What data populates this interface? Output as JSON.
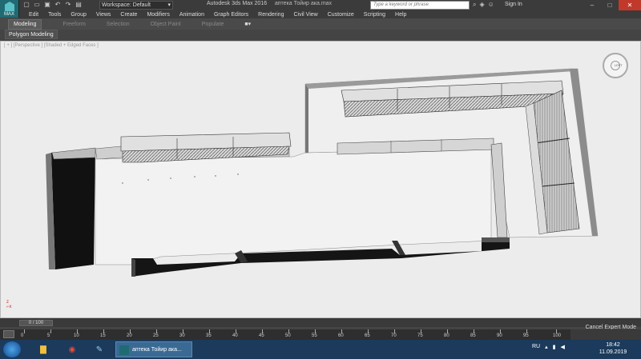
{
  "titlebar": {
    "app_badge": "MAX",
    "workspace": "Workspace: Default",
    "app_title": "Autodesk 3ds Max 2016",
    "file_name": "аптека Тойир ака.max",
    "search_placeholder": "Type a keyword or phrase",
    "sign_in": "Sign In"
  },
  "menu": [
    "Edit",
    "Tools",
    "Group",
    "Views",
    "Create",
    "Modifiers",
    "Animation",
    "Graph Editors",
    "Rendering",
    "Civil View",
    "Customize",
    "Scripting",
    "Help"
  ],
  "ribbon": {
    "tabs": [
      "Modeling",
      "Freeform",
      "Selection",
      "Object Paint",
      "Populate"
    ],
    "panel": "Polygon Modeling"
  },
  "viewport": {
    "label": "[ + ] [Perspective ] [Shaded + Edged Faces ]",
    "viewcube_label": "LEFT"
  },
  "timeline": {
    "frame": "0 / 100",
    "ticks": [
      "0",
      "5",
      "10",
      "15",
      "20",
      "25",
      "30",
      "35",
      "40",
      "45",
      "50",
      "55",
      "60",
      "65",
      "70",
      "75",
      "80",
      "85",
      "90",
      "95",
      "100"
    ],
    "expert_mode": "Cancel Expert Mode"
  },
  "taskbar": {
    "active_window": "аптека Тойир ака...",
    "language": "RU",
    "time": "18:42",
    "date": "11.09.2019"
  },
  "colors": {
    "chrome_dark": "#3b3b3b",
    "viewport_bg": "#ececec",
    "taskbar": "#1b3a5c",
    "close_red": "#c0392b"
  }
}
